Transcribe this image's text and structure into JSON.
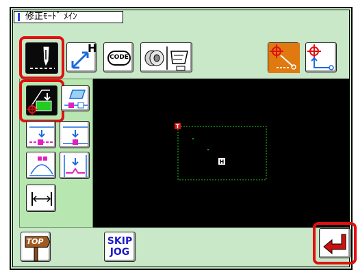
{
  "title": "修正ﾓｰﾄﾞ ﾒｲﾝ",
  "toolbar": {
    "code_label": "CODE",
    "h_label": "H"
  },
  "canvas": {
    "start_marker": "T",
    "home_marker": "H"
  },
  "bottom": {
    "top_label": "TOP",
    "skip_label": "SKIP",
    "jog_label": "JOG"
  },
  "colors": {
    "background": "#c8e8c8",
    "panel": "#b8e6b0",
    "canvas": "#000000",
    "highlight": "#e01010",
    "pattern": "#22cc22",
    "enter": "#cc1111"
  }
}
